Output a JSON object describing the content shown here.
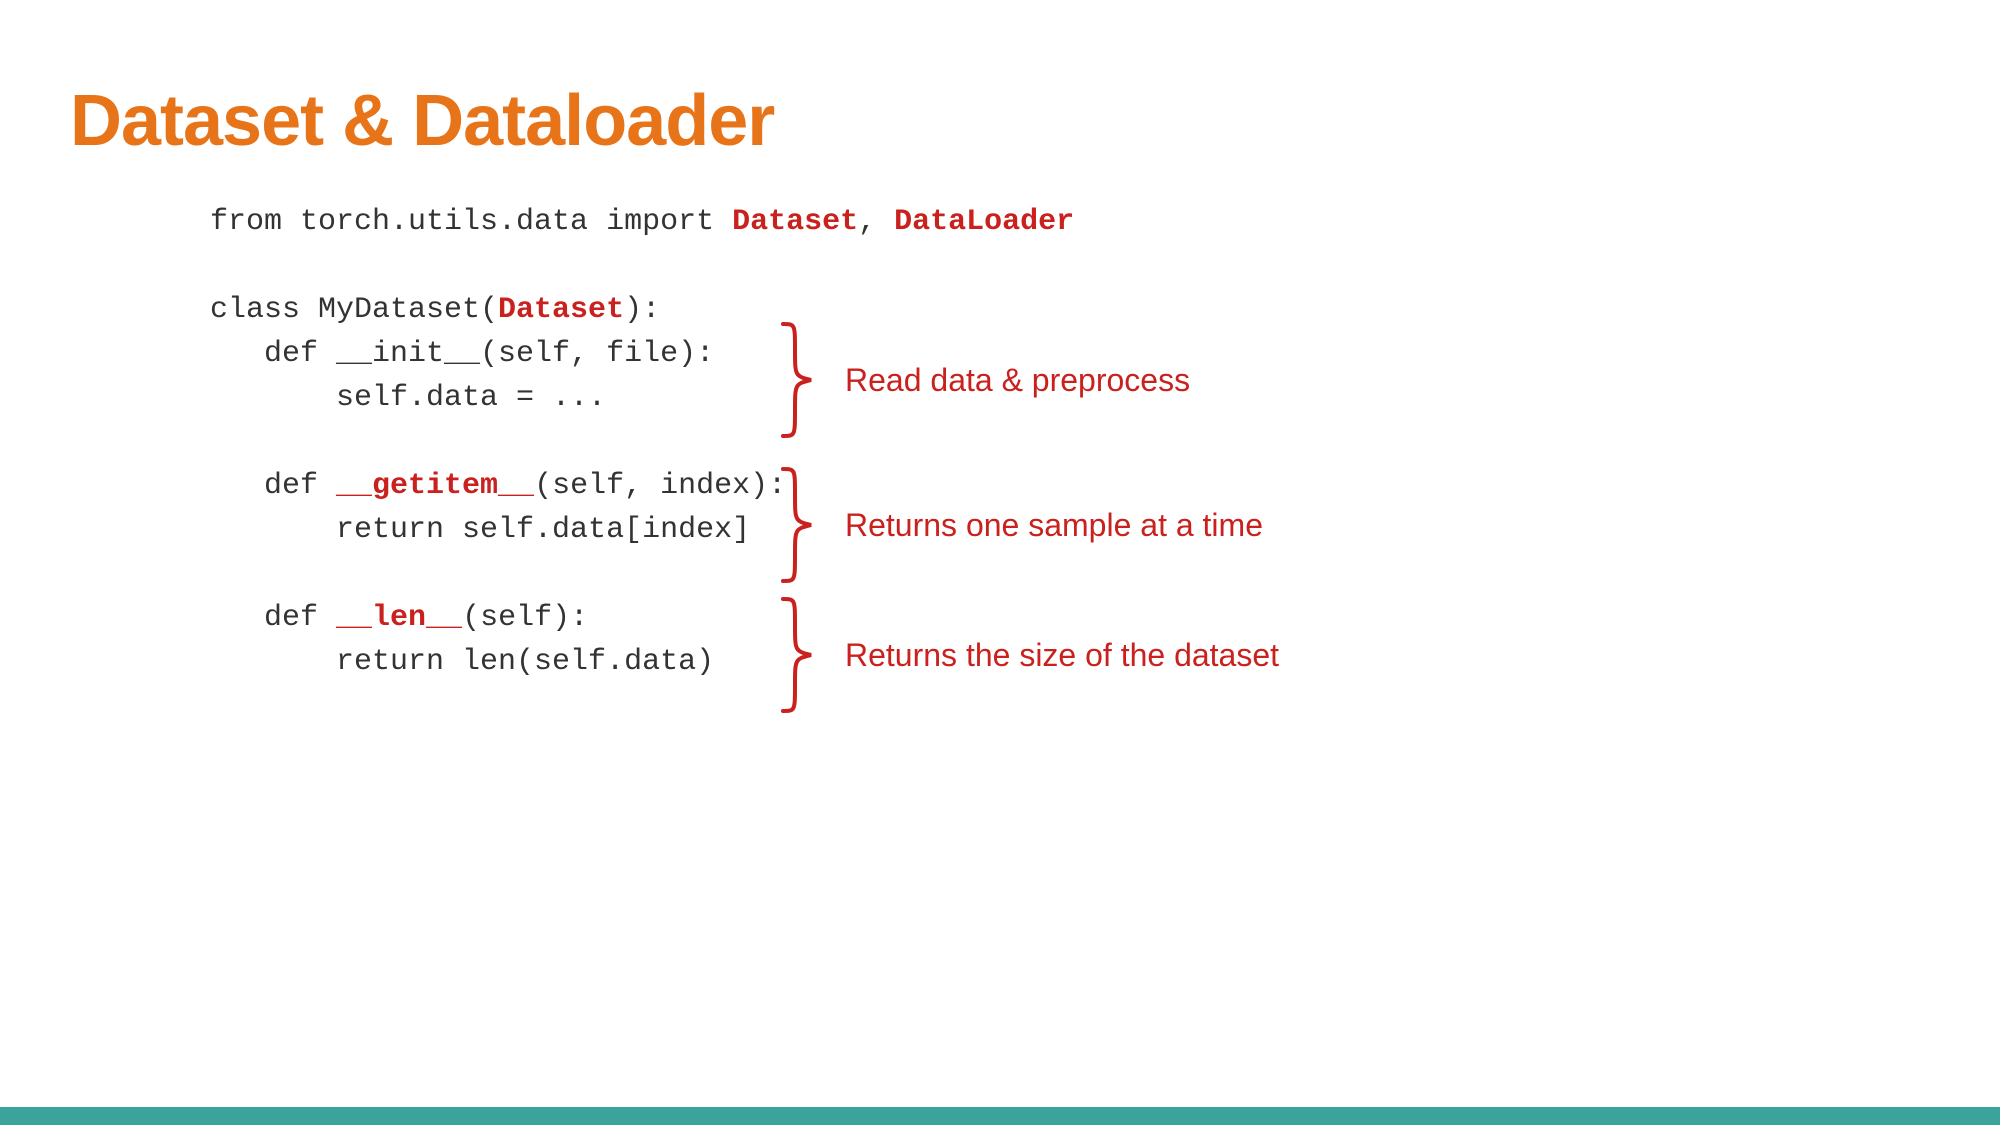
{
  "slide": {
    "title": "Dataset & Dataloader",
    "code": {
      "line1_pre": "from torch.utils.data import ",
      "line1_hl1": "Dataset",
      "line1_mid": ", ",
      "line1_hl2": "DataLoader",
      "line2": "",
      "line3_pre": "class MyDataset(",
      "line3_hl": "Dataset",
      "line3_post": "):",
      "line4": "   def __init__(self, file):",
      "line5": "       self.data = ...",
      "line6": "",
      "line7_pre": "   def ",
      "line7_hl": "__getitem__",
      "line7_post": "(self, index):",
      "line8": "       return self.data[index]",
      "line9": "",
      "line10_pre": "   def ",
      "line10_hl": "__len__",
      "line10_post": "(self):",
      "line11": "       return len(self.data)"
    },
    "annotations": {
      "a1": "Read data & preprocess",
      "a2": "Returns one sample at a time",
      "a3": "Returns the size of the dataset"
    }
  }
}
